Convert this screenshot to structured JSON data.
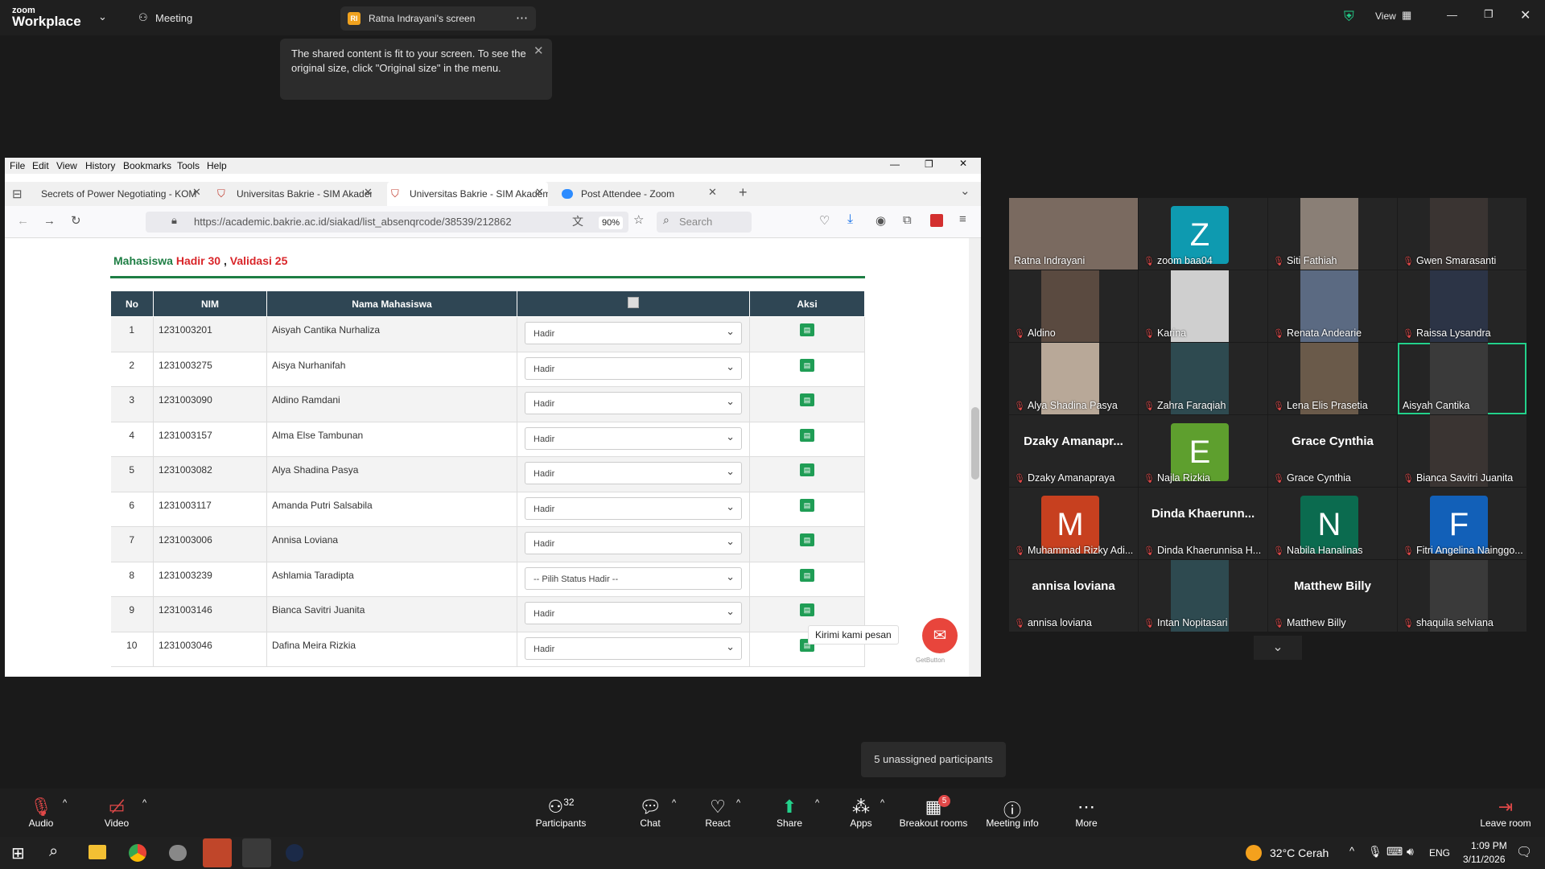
{
  "zoom": {
    "brand_small": "zoom",
    "brand_big": "Workplace",
    "meeting_label": "Meeting",
    "screen_tab": "Ratna Indrayani's screen",
    "screen_badge": "RI",
    "view_label": "View",
    "tooltip": "The shared content is fit to your screen. To see the original size, click \"Original size\" in the menu.",
    "breakout_tip": "5 unassigned participants"
  },
  "browser": {
    "menu": [
      "File",
      "Edit",
      "View",
      "History",
      "Bookmarks",
      "Tools",
      "Help"
    ],
    "tabs": [
      "Secrets of Power Negotiating - KOM",
      "Universitas Bakrie - SIM Akadem",
      "Universitas Bakrie - SIM Akadem",
      "Post Attendee - Zoom"
    ],
    "url": "https://academic.bakrie.ac.id/siakad/list_absenqrcode/38539/212862",
    "zoom_level": "90%",
    "search_placeholder": "Search"
  },
  "page": {
    "title_prefix": "Mahasiswa",
    "hadir": "Hadir 30",
    "comma": ",",
    "validasi": "Validasi 25",
    "headers": [
      "No",
      "NIM",
      "Nama Mahasiswa",
      "",
      "Aksi"
    ],
    "rows": [
      {
        "no": "1",
        "nim": "1231003201",
        "nama": "Aisyah Cantika Nurhaliza",
        "status": "Hadir"
      },
      {
        "no": "2",
        "nim": "1231003275",
        "nama": "Aisya Nurhanifah",
        "status": "Hadir"
      },
      {
        "no": "3",
        "nim": "1231003090",
        "nama": "Aldino Ramdani",
        "status": "Hadir"
      },
      {
        "no": "4",
        "nim": "1231003157",
        "nama": "Alma Else Tambunan",
        "status": "Hadir"
      },
      {
        "no": "5",
        "nim": "1231003082",
        "nama": "Alya Shadina Pasya",
        "status": "Hadir"
      },
      {
        "no": "6",
        "nim": "1231003117",
        "nama": "Amanda Putri Salsabila",
        "status": "Hadir"
      },
      {
        "no": "7",
        "nim": "1231003006",
        "nama": "Annisa Loviana",
        "status": "Hadir"
      },
      {
        "no": "8",
        "nim": "1231003239",
        "nama": "Ashlamia Taradipta",
        "status": "-- Pilih Status Hadir --"
      },
      {
        "no": "9",
        "nim": "1231003146",
        "nama": "Bianca Savitri Juanita",
        "status": "Hadir"
      },
      {
        "no": "10",
        "nim": "1231003046",
        "nama": "Dafina Meira Rizkia",
        "status": "Hadir"
      }
    ],
    "chat_bubble": "Kirimi kami pesan",
    "getbutton": "GetButton"
  },
  "participants": [
    {
      "name": "Ratna Indrayani",
      "type": "photo",
      "muted": false
    },
    {
      "name": "zoom baa04",
      "type": "letter",
      "letter": "Z",
      "color": "#0e9ab0",
      "muted": true
    },
    {
      "name": "Siti Fathiah",
      "type": "photo",
      "muted": true
    },
    {
      "name": "Gwen Smarasanti",
      "type": "photo",
      "muted": true
    },
    {
      "name": "Aldino",
      "type": "photo",
      "muted": true
    },
    {
      "name": "Karina",
      "type": "photo",
      "muted": true
    },
    {
      "name": "Renata Andearie",
      "type": "photo",
      "muted": true
    },
    {
      "name": "Raissa Lysandra",
      "type": "photo",
      "muted": true
    },
    {
      "name": "Alya Shadina Pasya",
      "type": "photo",
      "muted": true
    },
    {
      "name": "Zahra Faraqiah",
      "type": "photo",
      "muted": true
    },
    {
      "name": "Lena Elis Prasetia",
      "type": "photo",
      "muted": true
    },
    {
      "name": "Aisyah Cantika",
      "type": "photo",
      "muted": false,
      "active": true
    },
    {
      "name": "Dzaky Amanapraya",
      "type": "bigname",
      "big": "Dzaky  Amanapr...",
      "muted": true
    },
    {
      "name": "Najla Rizkia",
      "type": "letter",
      "letter": "E",
      "color": "#5e9f2e",
      "muted": true
    },
    {
      "name": "Grace Cynthia",
      "type": "bigname",
      "big": "Grace Cynthia",
      "muted": true
    },
    {
      "name": "Bianca Savitri Juanita",
      "type": "photo",
      "muted": true
    },
    {
      "name": "Muhammad Rizky Adi...",
      "type": "letter",
      "letter": "M",
      "color": "#c7401f",
      "muted": true
    },
    {
      "name": "Dinda Khaerunnisa H...",
      "type": "bigname",
      "big": "Dinda  Khaerunn...",
      "muted": true
    },
    {
      "name": "Nabila Hanalinas",
      "type": "letter",
      "letter": "N",
      "color": "#0b6b4f",
      "muted": true
    },
    {
      "name": "Fitri Angelina Nainggo...",
      "type": "letter",
      "letter": "F",
      "color": "#1260b8",
      "muted": true
    },
    {
      "name": "annisa loviana",
      "type": "bigname",
      "big": "annisa loviana",
      "muted": true
    },
    {
      "name": "Intan Nopitasari",
      "type": "photo",
      "muted": true
    },
    {
      "name": "Matthew Billy",
      "type": "bigname",
      "big": "Matthew Billy",
      "muted": true
    },
    {
      "name": "shaquila selviana",
      "type": "photo",
      "muted": true
    }
  ],
  "controls": {
    "audio": "Audio",
    "video": "Video",
    "participants": "Participants",
    "participant_count": "32",
    "chat": "Chat",
    "react": "React",
    "share": "Share",
    "apps": "Apps",
    "breakout": "Breakout rooms",
    "breakout_badge": "5",
    "meeting_info": "Meeting info",
    "more": "More",
    "leave": "Leave room"
  },
  "taskbar": {
    "weather": "32°C  Cerah",
    "lang": "ENG",
    "time": "1:09 PM",
    "date": "3/11/2026",
    "notif": "2"
  },
  "colors": {
    "green": "#1e7e44",
    "red": "#d9262a",
    "header": "#2f4654"
  }
}
